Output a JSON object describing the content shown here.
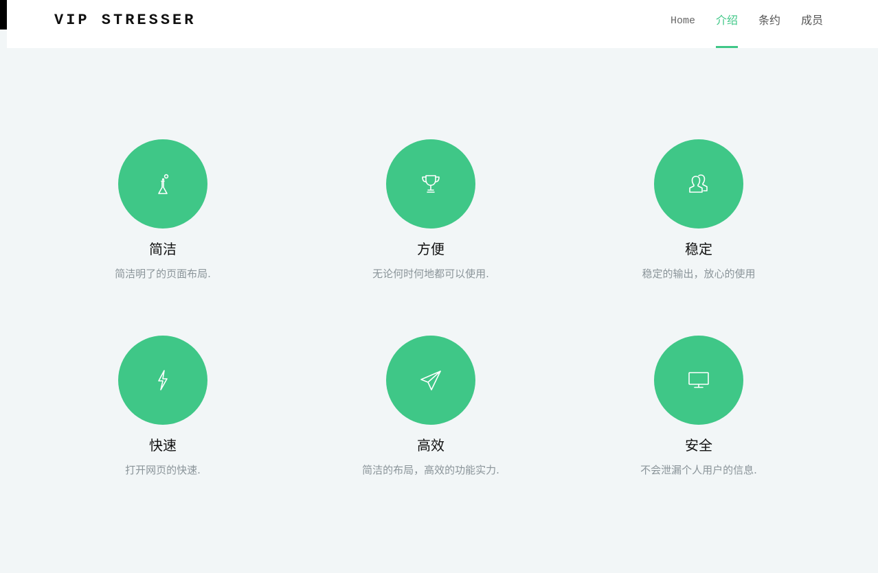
{
  "header": {
    "brand": "VIP STRESSER",
    "nav": [
      {
        "label": "Home",
        "active": false
      },
      {
        "label": "介绍",
        "active": true
      },
      {
        "label": "条约",
        "active": false
      },
      {
        "label": "成员",
        "active": false
      }
    ]
  },
  "colors": {
    "accent": "#3fc787",
    "background": "#f2f6f7",
    "header_bg": "#ffffff",
    "description_text": "#8a9499"
  },
  "features": [
    {
      "icon": "flask-icon",
      "title": "简洁",
      "description": "简洁明了的页面布局."
    },
    {
      "icon": "trophy-icon",
      "title": "方便",
      "description": "无论何时何地都可以使用."
    },
    {
      "icon": "users-icon",
      "title": "稳定",
      "description": "稳定的输出，放心的使用"
    },
    {
      "icon": "lightning-icon",
      "title": "快速",
      "description": "打开网页的快速."
    },
    {
      "icon": "paper-plane-icon",
      "title": "高效",
      "description": "简洁的布局，高效的功能实力."
    },
    {
      "icon": "monitor-icon",
      "title": "安全",
      "description": "不会泄漏个人用户的信息."
    }
  ]
}
